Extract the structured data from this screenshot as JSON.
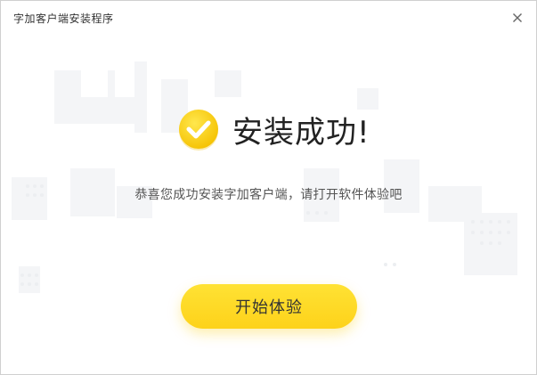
{
  "window": {
    "title": "字加客户端安装程序"
  },
  "main": {
    "success_title": "安装成功!",
    "subtitle": "恭喜您成功安装字加客户端，请打开软件体验吧",
    "start_button_label": "开始体验"
  },
  "icons": {
    "close": "close-icon",
    "success": "check-circle-icon"
  },
  "colors": {
    "accent": "#fdd21a",
    "title_text": "#222222",
    "body_text": "#555555"
  }
}
